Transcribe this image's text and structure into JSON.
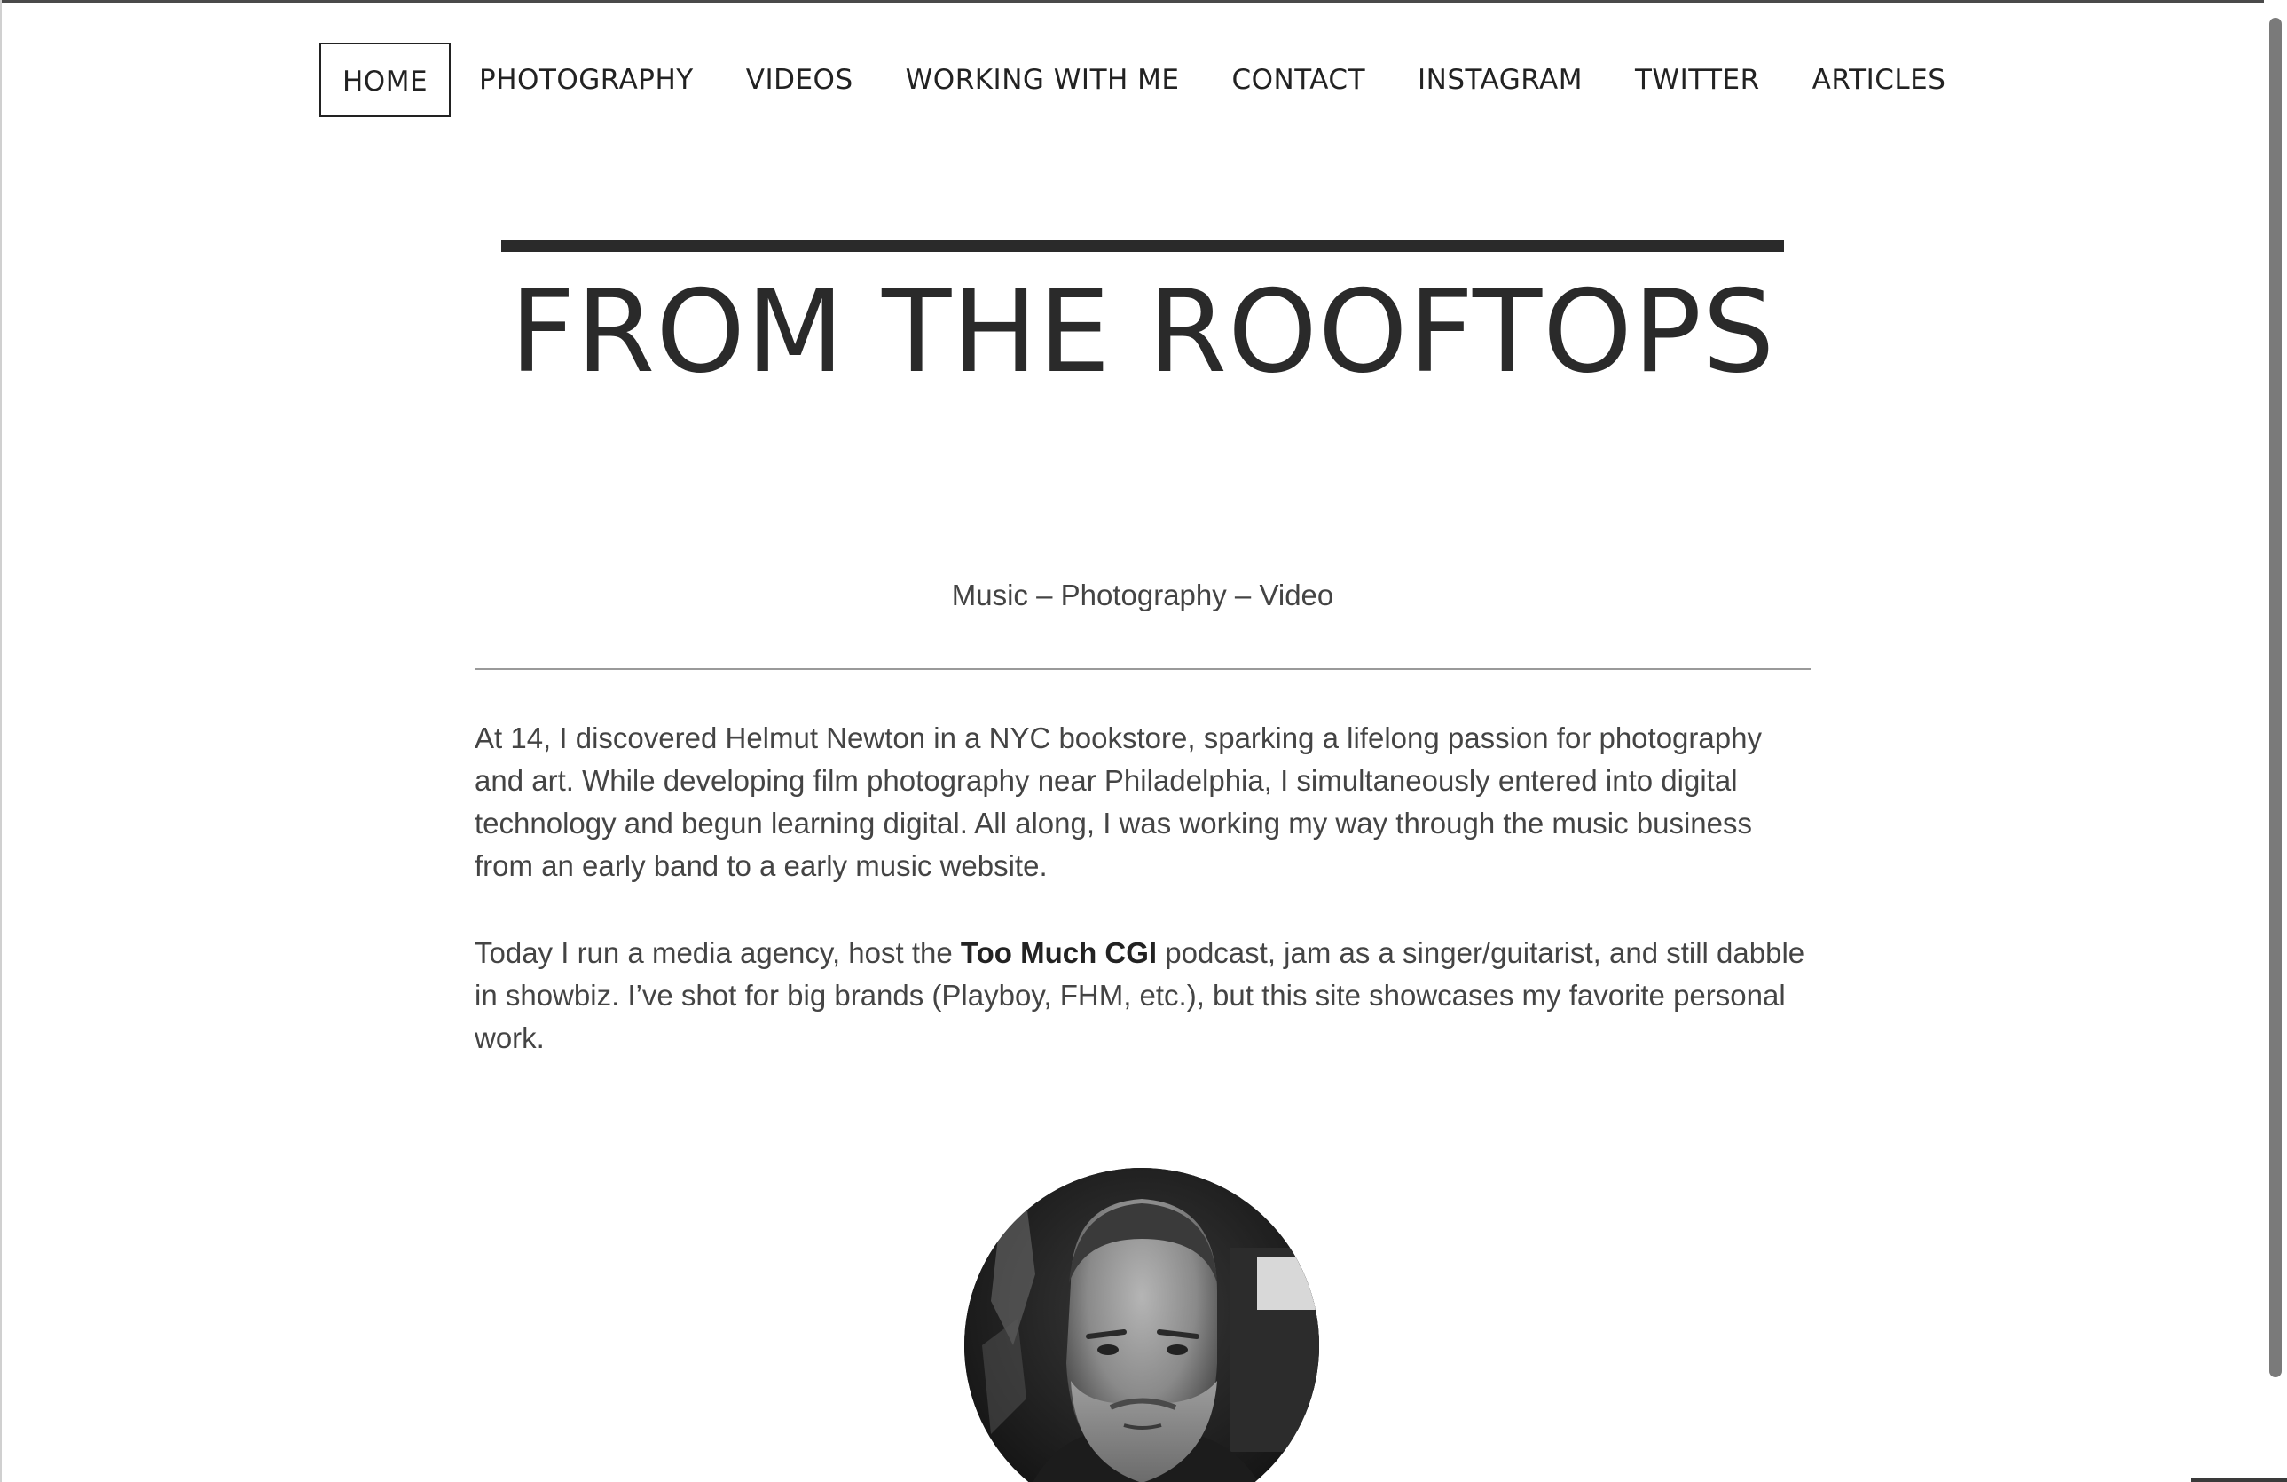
{
  "nav": {
    "items": [
      {
        "label": "HOME",
        "active": true
      },
      {
        "label": "PHOTOGRAPHY",
        "active": false
      },
      {
        "label": "VIDEOS",
        "active": false
      },
      {
        "label": "WORKING WITH ME",
        "active": false
      },
      {
        "label": "CONTACT",
        "active": false
      },
      {
        "label": "INSTAGRAM",
        "active": false
      },
      {
        "label": "TWITTER",
        "active": false
      },
      {
        "label": "ARTICLES",
        "active": false
      }
    ]
  },
  "header": {
    "title": "FROM THE ROOFTOPS",
    "tagline": "Music – Photography – Video"
  },
  "about": {
    "paragraph1": "At 14, I discovered Helmut Newton in a NYC bookstore, sparking a lifelong passion for photography and art. While developing film photography near Philadelphia, I simultaneously entered into digital technology and begun learning digital. All along, I was working my way through the music business from an early band to a early music website.",
    "paragraph2_before": "Today I run a media agency, host the ",
    "paragraph2_bold": "Too Much CGI",
    "paragraph2_after": " podcast, jam as a singer/guitarist, and still dabble in showbiz. I’ve shot for big brands (Playboy, FHM, etc.), but this site showcases my favorite personal work."
  },
  "colors": {
    "text": "#444444",
    "title": "#2a2a2a",
    "background": "#ffffff"
  }
}
